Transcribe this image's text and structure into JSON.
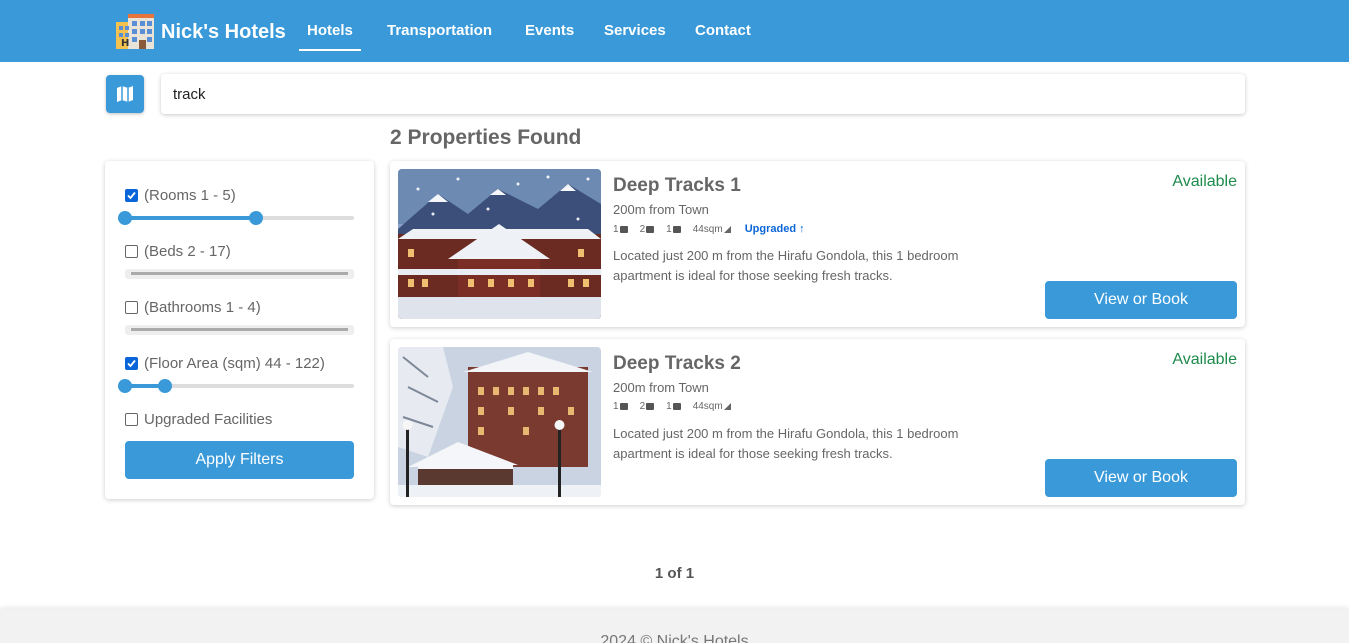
{
  "brand": {
    "name": "Nick's Hotels",
    "logo_icon": "hotel-building-icon"
  },
  "nav": {
    "items": [
      {
        "label": "Hotels",
        "active": true
      },
      {
        "label": "Transportation",
        "active": false
      },
      {
        "label": "Events",
        "active": false
      },
      {
        "label": "Services",
        "active": false
      },
      {
        "label": "Contact",
        "active": false
      }
    ]
  },
  "search": {
    "map_icon": "map-icon",
    "value": "track"
  },
  "results": {
    "title": "2 Properties Found"
  },
  "filters": {
    "rooms": {
      "label": "(Rooms 1 - 5)",
      "checked": true,
      "min": 1,
      "max": 5
    },
    "beds": {
      "label": "(Beds 2 - 17)",
      "checked": false
    },
    "bathrooms": {
      "label": "(Bathrooms 1 - 4)",
      "checked": false
    },
    "floor_area": {
      "label": "(Floor Area (sqm) 44 - 122)",
      "checked": true,
      "min": 44,
      "max": 122
    },
    "upgraded": {
      "label": "Upgraded Facilities",
      "checked": false
    },
    "apply_label": "Apply Filters"
  },
  "properties": [
    {
      "name": "Deep Tracks 1",
      "distance": "200m from Town",
      "rooms": "1",
      "beds": "2",
      "baths": "1",
      "area": "44sqm",
      "upgraded": "Upgraded ↑",
      "description": "Located just 200 m from the Hirafu Gondola, this 1 bedroom apartment is ideal for those seeking fresh tracks.",
      "status": "Available",
      "book_label": "View or Book"
    },
    {
      "name": "Deep Tracks 2",
      "distance": "200m from Town",
      "rooms": "1",
      "beds": "2",
      "baths": "1",
      "area": "44sqm",
      "upgraded": "",
      "description": "Located just 200 m from the Hirafu Gondola, this 1 bedroom apartment is ideal for those seeking fresh tracks.",
      "status": "Available",
      "book_label": "View or Book"
    }
  ],
  "pagination": {
    "label": "1 of 1"
  },
  "footer": {
    "text": "2024 © Nick's Hotels"
  },
  "colors": {
    "primary": "#3a9ad9",
    "available": "#1e8a4c",
    "upgraded": "#0a66d8"
  }
}
